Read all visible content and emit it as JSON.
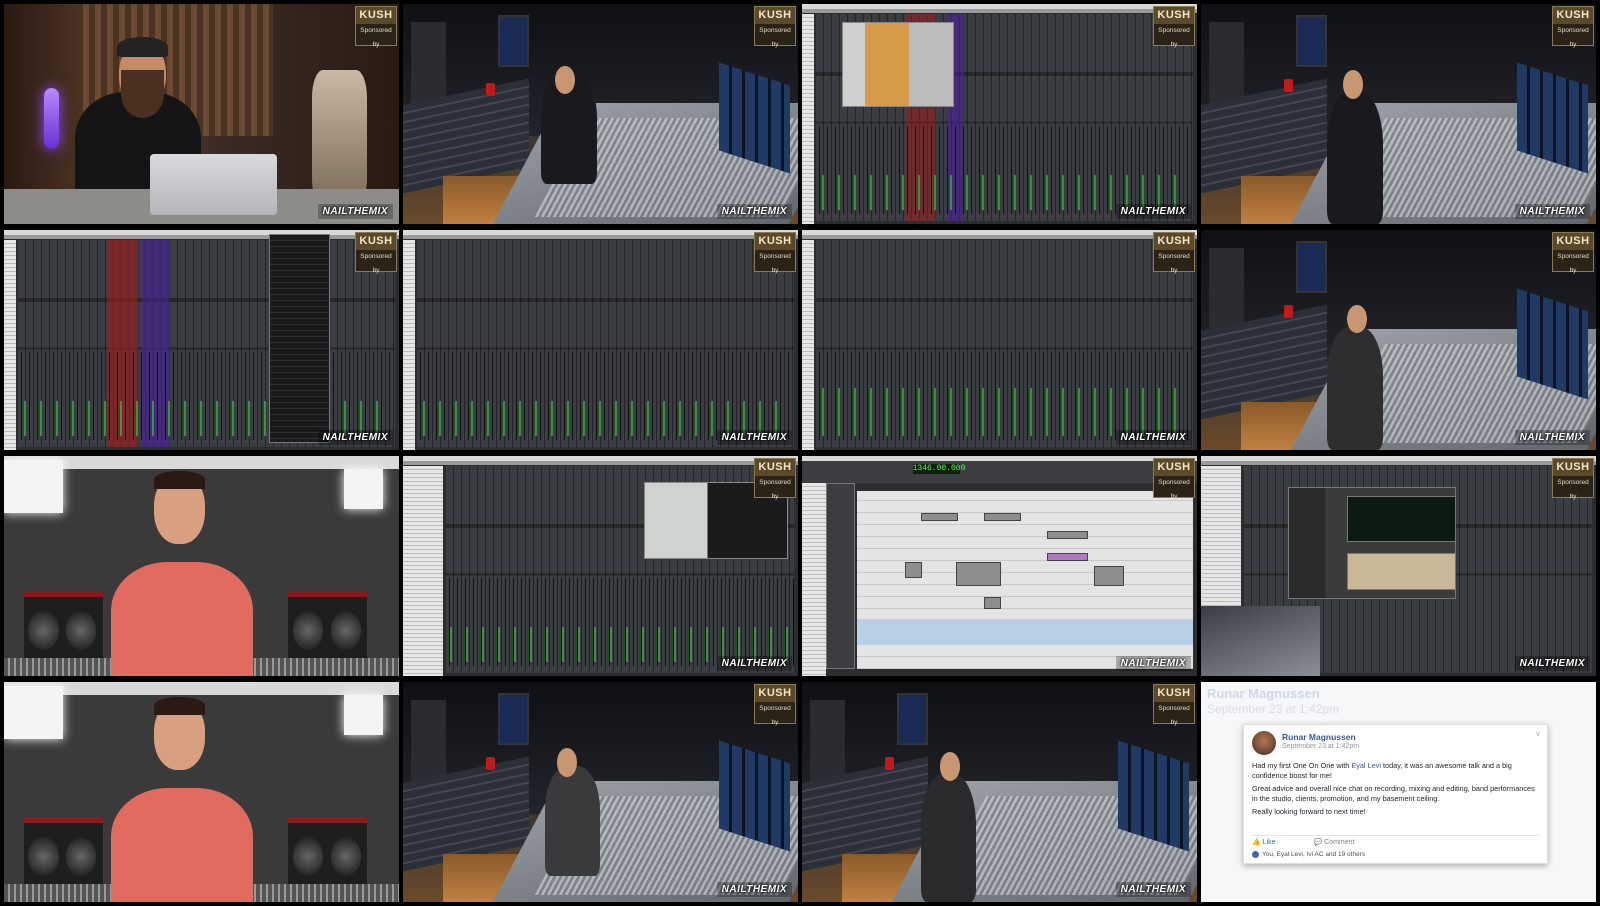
{
  "badges": {
    "sponsor_brand": "KUSH",
    "sponsor_text": "Sponsored by",
    "watermark": "NAILTHEMIX"
  },
  "daw": {
    "counter_value": "1346.00.000"
  },
  "facebook_post": {
    "ghost_name": "Runar Magnussen",
    "ghost_date": "September 23 at 1:42pm",
    "author": "Runar Magnussen",
    "date": "September 23 at 1:42pm",
    "body_pre": "Had my first One On One with ",
    "body_tag": "Eyal Levi",
    "body_post": " today, it was an awesome talk and a big confidence boost for me!",
    "body_p2": "Great advice and overall nice chat on recording, mixing and editing, band performances in the studio, clients, promotion, and my basement ceiling.",
    "body_p3": "Really looking forward to next time!",
    "like_label": "Like",
    "comment_label": "Comment",
    "reactions": "You, Eyal Levi, Ivi AC and 19 others"
  },
  "colors": {
    "fb_link": "#365899",
    "meter_green": "#2fb32f",
    "track_red": "#b01818",
    "track_purple": "#4a1fa0"
  }
}
